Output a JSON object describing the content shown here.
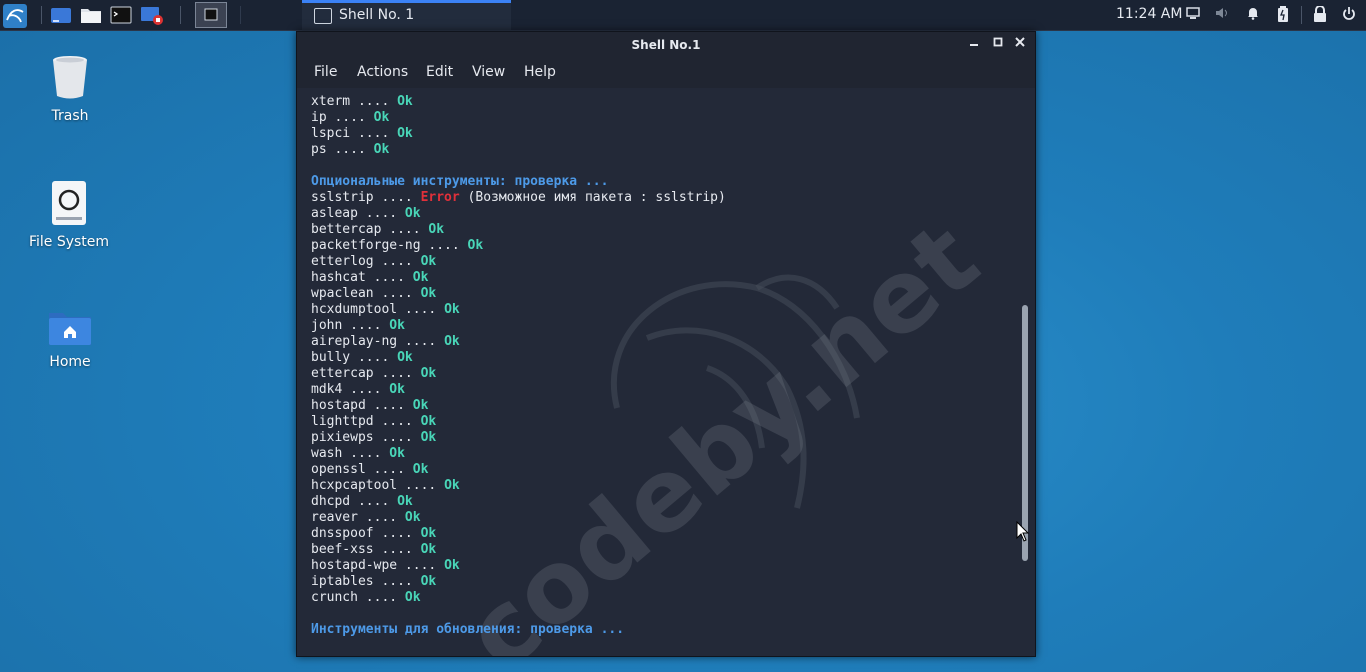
{
  "panel": {
    "task_title": "Shell No. 1",
    "clock": "11:24 AM",
    "launchers": [
      "kali-menu-icon",
      "show-desktop-icon",
      "file-manager-icon",
      "terminal-icon",
      "screen-record-icon",
      "workspace-1-icon"
    ]
  },
  "desktop": {
    "icons": [
      {
        "label": "Trash"
      },
      {
        "label": "File System"
      },
      {
        "label": "Home"
      }
    ]
  },
  "window": {
    "title": "Shell No.1",
    "menu": [
      "File",
      "Actions",
      "Edit",
      "View",
      "Help"
    ]
  },
  "terminal": {
    "ok": "Ok",
    "error": "Error",
    "lines_top": [
      "xterm ....",
      "ip ....",
      "lspci ....",
      "ps ...."
    ],
    "optional_header": "Опциональные инструменты: проверка ...",
    "sslstrip_name": "sslstrip ....",
    "sslstrip_note": "(Возможное имя пакета : sslstrip)",
    "tools": [
      "asleap ....",
      "bettercap ....",
      "packetforge-ng ....",
      "etterlog ....",
      "hashcat ....",
      "wpaclean ....",
      "hcxdumptool ....",
      "john ....",
      "aireplay-ng ....",
      "bully ....",
      "ettercap ....",
      "mdk4 ....",
      "hostapd ....",
      "lighttpd ....",
      "pixiewps ....",
      "wash ....",
      "openssl ....",
      "hcxpcaptool ....",
      "dhcpd ....",
      "reaver ....",
      "dnsspoof ....",
      "beef-xss ....",
      "hostapd-wpe ....",
      "iptables ....",
      "crunch ...."
    ],
    "update_header": "Инструменты для обновления: проверка ...",
    "watermark": "codeby.net"
  },
  "colors": {
    "ok": "#49d6b8",
    "error": "#e0303a",
    "header": "#4d9ae8",
    "terminal_bg": "#232938",
    "desktop_bg": "#1f7dba"
  }
}
